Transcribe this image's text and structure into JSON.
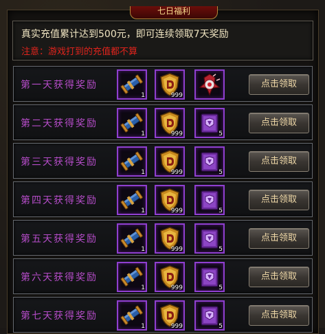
{
  "title": "七日福利",
  "notice": {
    "line1": "真实充值累计达到500元，即可连续领取7天奖励",
    "line2": "注意：游戏打到的充值都不算"
  },
  "claim_label": "点击领取",
  "rows": [
    {
      "label": "第一天获得奖励",
      "items": [
        {
          "icon": "scroll-icon",
          "count": "1"
        },
        {
          "icon": "gold-shield-icon",
          "count": "999"
        },
        {
          "icon": "red-gem-icon",
          "count": ""
        }
      ]
    },
    {
      "label": "第二天获得奖励",
      "items": [
        {
          "icon": "scroll-icon",
          "count": "1"
        },
        {
          "icon": "gold-shield-icon",
          "count": "999"
        },
        {
          "icon": "purple-book-icon",
          "count": "5"
        }
      ]
    },
    {
      "label": "第三天获得奖励",
      "items": [
        {
          "icon": "scroll-icon",
          "count": "1"
        },
        {
          "icon": "gold-shield-icon",
          "count": "999"
        },
        {
          "icon": "purple-book-icon",
          "count": "5"
        }
      ]
    },
    {
      "label": "第四天获得奖励",
      "items": [
        {
          "icon": "scroll-icon",
          "count": "1"
        },
        {
          "icon": "gold-shield-icon",
          "count": "999"
        },
        {
          "icon": "purple-book-icon",
          "count": "5"
        }
      ]
    },
    {
      "label": "第五天获得奖励",
      "items": [
        {
          "icon": "scroll-icon",
          "count": "1"
        },
        {
          "icon": "gold-shield-icon",
          "count": "999"
        },
        {
          "icon": "purple-book-icon",
          "count": "5"
        }
      ]
    },
    {
      "label": "第六天获得奖励",
      "items": [
        {
          "icon": "scroll-icon",
          "count": "1"
        },
        {
          "icon": "gold-shield-icon",
          "count": "999"
        },
        {
          "icon": "purple-book-icon",
          "count": "5"
        }
      ]
    },
    {
      "label": "第七天获得奖励",
      "items": [
        {
          "icon": "scroll-icon",
          "count": "1"
        },
        {
          "icon": "gold-shield-icon",
          "count": "999"
        },
        {
          "icon": "purple-book-icon",
          "count": "5"
        }
      ]
    }
  ],
  "colors": {
    "row_label": "#b54cc8",
    "notice_text": "#f0e5c2",
    "warning_text": "#e0231c",
    "slot_border": "#8f3fd0",
    "button_text": "#f0d9a8"
  }
}
